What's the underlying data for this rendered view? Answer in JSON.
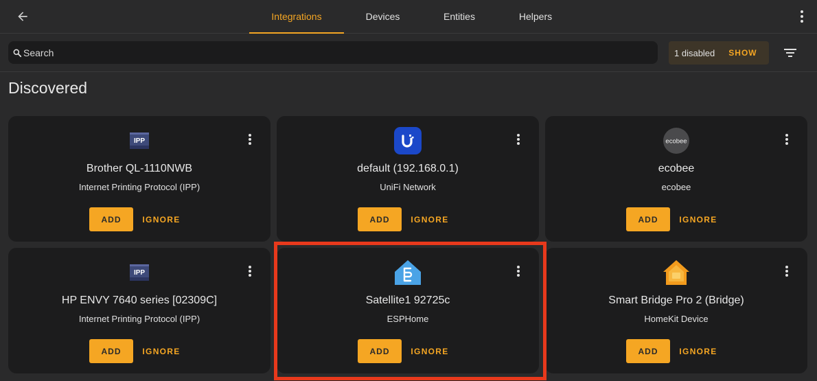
{
  "header": {
    "tabs": [
      {
        "label": "Integrations",
        "active": true
      },
      {
        "label": "Devices",
        "active": false
      },
      {
        "label": "Entities",
        "active": false
      },
      {
        "label": "Helpers",
        "active": false
      }
    ]
  },
  "search": {
    "placeholder": "Search",
    "value": ""
  },
  "filter_bar": {
    "disabled_text": "1 disabled",
    "show_label": "SHOW"
  },
  "section": {
    "title": "Discovered"
  },
  "cards": [
    {
      "title": "Brother QL-1110NWB",
      "subtitle": "Internet Printing Protocol (IPP)",
      "logo": "ipp-logo",
      "logo_text": "IPP",
      "add_label": "ADD",
      "ignore_label": "IGNORE"
    },
    {
      "title": "default (192.168.0.1)",
      "subtitle": "UniFi Network",
      "logo": "unifi-logo",
      "add_label": "ADD",
      "ignore_label": "IGNORE"
    },
    {
      "title": "ecobee",
      "subtitle": "ecobee",
      "logo": "ecobee-logo",
      "logo_text": "ecobee",
      "add_label": "ADD",
      "ignore_label": "IGNORE"
    },
    {
      "title": "HP ENVY 7640 series [02309C]",
      "subtitle": "Internet Printing Protocol (IPP)",
      "logo": "ipp-logo",
      "logo_text": "IPP",
      "add_label": "ADD",
      "ignore_label": "IGNORE"
    },
    {
      "title": "Satellite1 92725c",
      "subtitle": "ESPHome",
      "logo": "esphome-logo",
      "add_label": "ADD",
      "ignore_label": "IGNORE",
      "highlighted": true
    },
    {
      "title": "Smart Bridge Pro 2 (Bridge)",
      "subtitle": "HomeKit Device",
      "logo": "homekit-logo",
      "add_label": "ADD",
      "ignore_label": "IGNORE"
    }
  ],
  "colors": {
    "accent": "#f5a623",
    "background": "#2a2a2b",
    "card": "#1c1c1d",
    "highlight": "#e8391c"
  }
}
